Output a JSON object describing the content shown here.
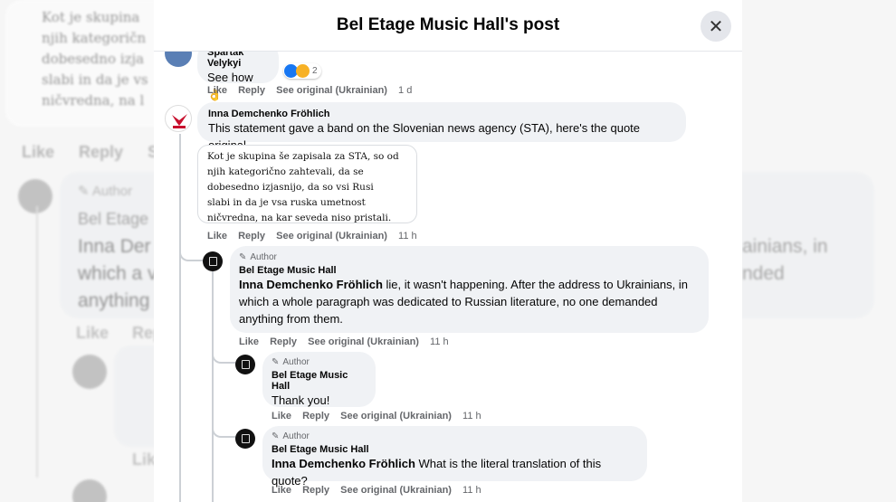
{
  "background": {
    "card_lines": [
      "Kot je skupina",
      "njih kategoričn",
      "dobesedno izja",
      "slabi in da je vs",
      "ničvredna, na l"
    ],
    "actions": [
      "Like",
      "Reply",
      "S"
    ],
    "author_badge": "Author",
    "bubble_name": "Bel Etage",
    "bubble_mention": "Inna Der",
    "bubble_line2": "which a v",
    "bubble_line3": "anything",
    "bubble_right1": "ainians, in",
    "bubble_right2": "nded",
    "like_labels": [
      "Like",
      "Rep",
      "Lik"
    ]
  },
  "modal": {
    "title": "Bel Etage Music Hall's post",
    "close_icon": "close-icon"
  },
  "comments": {
    "spartak": {
      "name": "Spartak Velykyi",
      "text": "See how 👌",
      "reaction_count": "2",
      "actions": [
        "Like",
        "Reply",
        "See original (Ukrainian)"
      ],
      "time": "1 d"
    },
    "inna": {
      "name": "Inna Demchenko Fröhlich",
      "text": "This statement gave a band on the Slovenian news agency (STA), here's the quote original",
      "quote_lines": [
        "Kot je skupina še zapisala za STA, so od",
        "njih kategorično zahtevali, da se",
        "dobesedno izjasnijo, da so vsi Rusi",
        "slabi in da je vsa ruska umetnost",
        "ničvredna, na kar seveda niso pristali."
      ],
      "actions": [
        "Like",
        "Reply",
        "See original (Ukrainian)"
      ],
      "time": "11 h"
    },
    "reply1": {
      "badge": "Author",
      "name": "Bel Etage Music Hall",
      "mention": "Inna Demchenko Fröhlich",
      "text": " lie, it wasn't happening. After the address to Ukrainians, in which a whole paragraph was dedicated to Russian literature, no one demanded anything from them.",
      "actions": [
        "Like",
        "Reply",
        "See original (Ukrainian)"
      ],
      "time": "11 h"
    },
    "reply2": {
      "badge": "Author",
      "name": "Bel Etage Music Hall",
      "text": "Thank you!",
      "actions": [
        "Like",
        "Reply",
        "See original (Ukrainian)"
      ],
      "time": "11 h"
    },
    "reply3": {
      "badge": "Author",
      "name": "Bel Etage Music Hall",
      "mention": "Inna Demchenko Fröhlich",
      "text": " What is the literal translation of this quote?",
      "actions": [
        "Like",
        "Reply",
        "See original (Ukrainian)"
      ],
      "time": "11 h"
    }
  },
  "colors": {
    "like_blue": "#1877f2",
    "haha_yellow": "#f7b125",
    "secondary_text": "#65676b"
  }
}
